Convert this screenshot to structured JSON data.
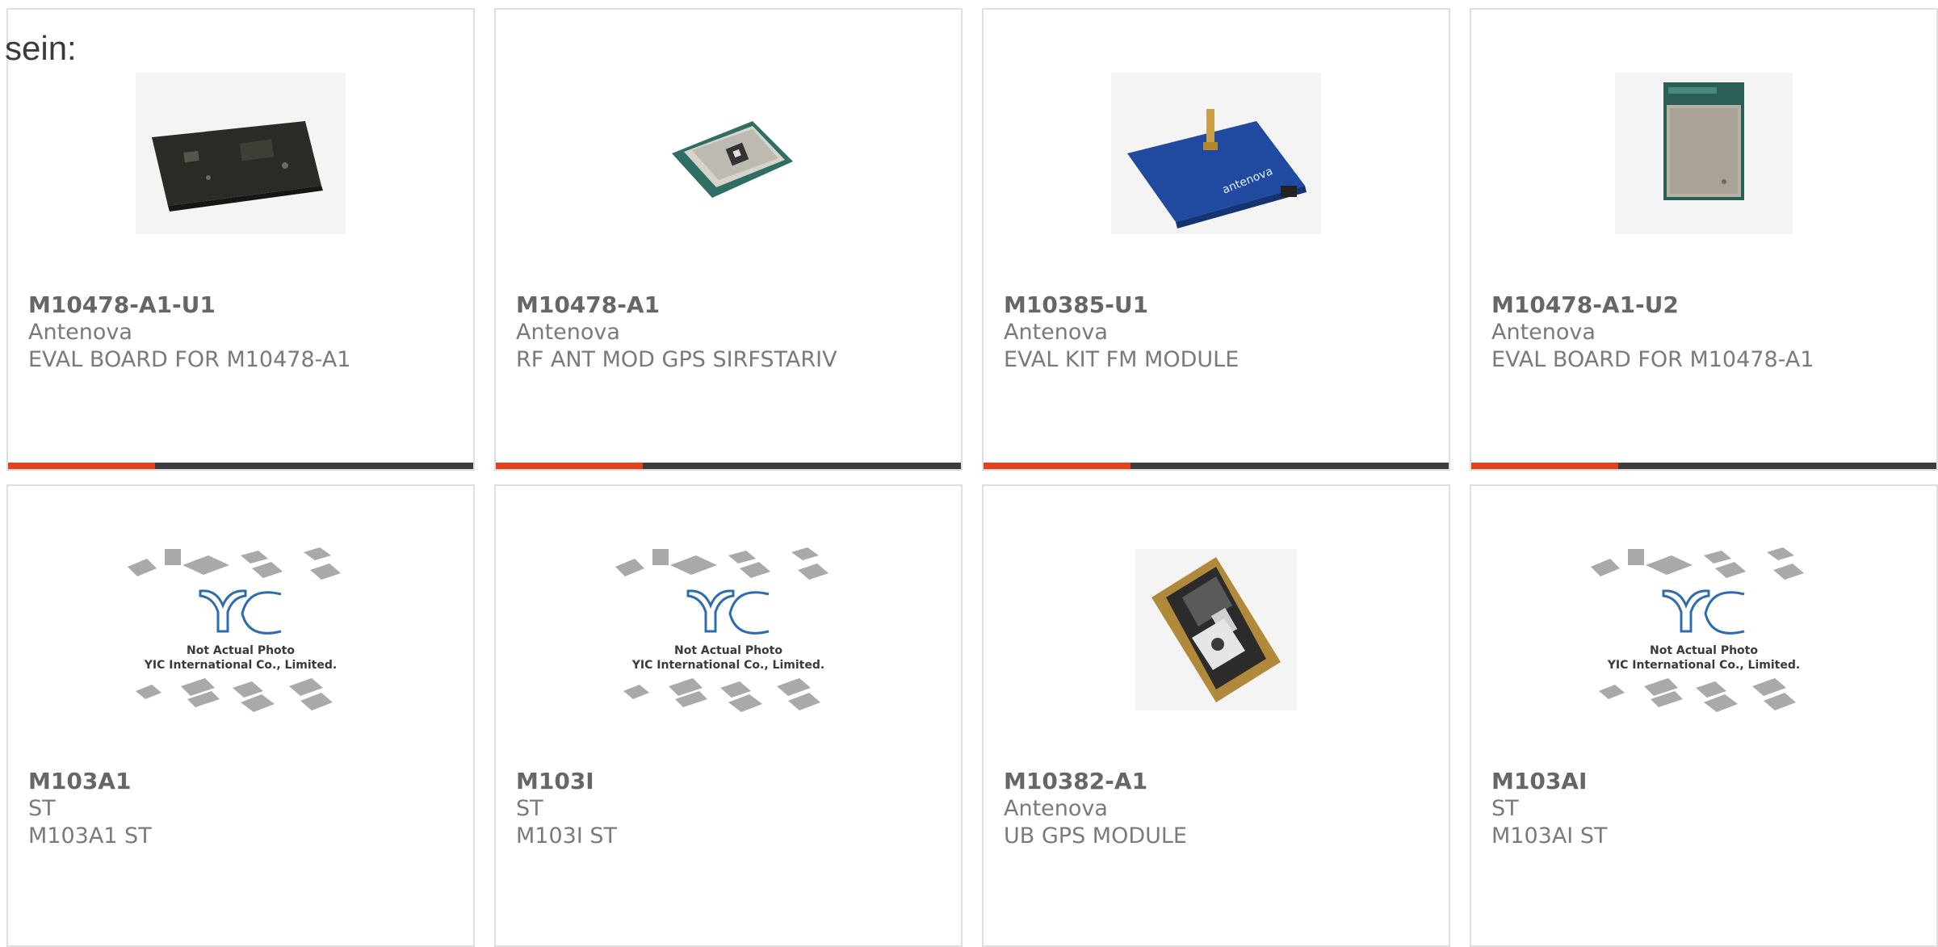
{
  "intro_text": "sein:",
  "colors": {
    "accent": "#e8401c",
    "bar": "#3d3d3d",
    "border": "#dedede",
    "text": "#7a7a7a"
  },
  "products": [
    {
      "part": "M10478-A1-U1",
      "maker": "Antenova",
      "desc": "EVAL BOARD FOR M10478-A1",
      "image_icon": "eval-board-photo"
    },
    {
      "part": "M10478-A1",
      "maker": "Antenova",
      "desc": "RF ANT MOD GPS SIRFSTARIV",
      "image_icon": "gps-module-photo"
    },
    {
      "part": "M10385-U1",
      "maker": "Antenova",
      "desc": "EVAL KIT FM MODULE",
      "image_icon": "blue-eval-kit-photo"
    },
    {
      "part": "M10478-A1-U2",
      "maker": "Antenova",
      "desc": "EVAL BOARD FOR M10478-A1",
      "image_icon": "shielded-module-photo"
    },
    {
      "part": "M103A1",
      "maker": "ST",
      "desc": "M103A1 ST",
      "image_icon": "placeholder-photo",
      "placeholder": {
        "line1": "Not Actual Photo",
        "line2": "YIC International Co., Limited."
      }
    },
    {
      "part": "M103I",
      "maker": "ST",
      "desc": "M103I ST",
      "image_icon": "placeholder-photo",
      "placeholder": {
        "line1": "Not Actual Photo",
        "line2": "YIC International Co., Limited."
      }
    },
    {
      "part": "M10382-A1",
      "maker": "Antenova",
      "desc": "UB GPS MODULE",
      "image_icon": "ub-gps-module-photo"
    },
    {
      "part": "M103AI",
      "maker": "ST",
      "desc": "M103AI ST",
      "image_icon": "placeholder-photo",
      "placeholder": {
        "line1": "Not Actual Photo",
        "line2": "YIC International Co., Limited."
      }
    }
  ]
}
